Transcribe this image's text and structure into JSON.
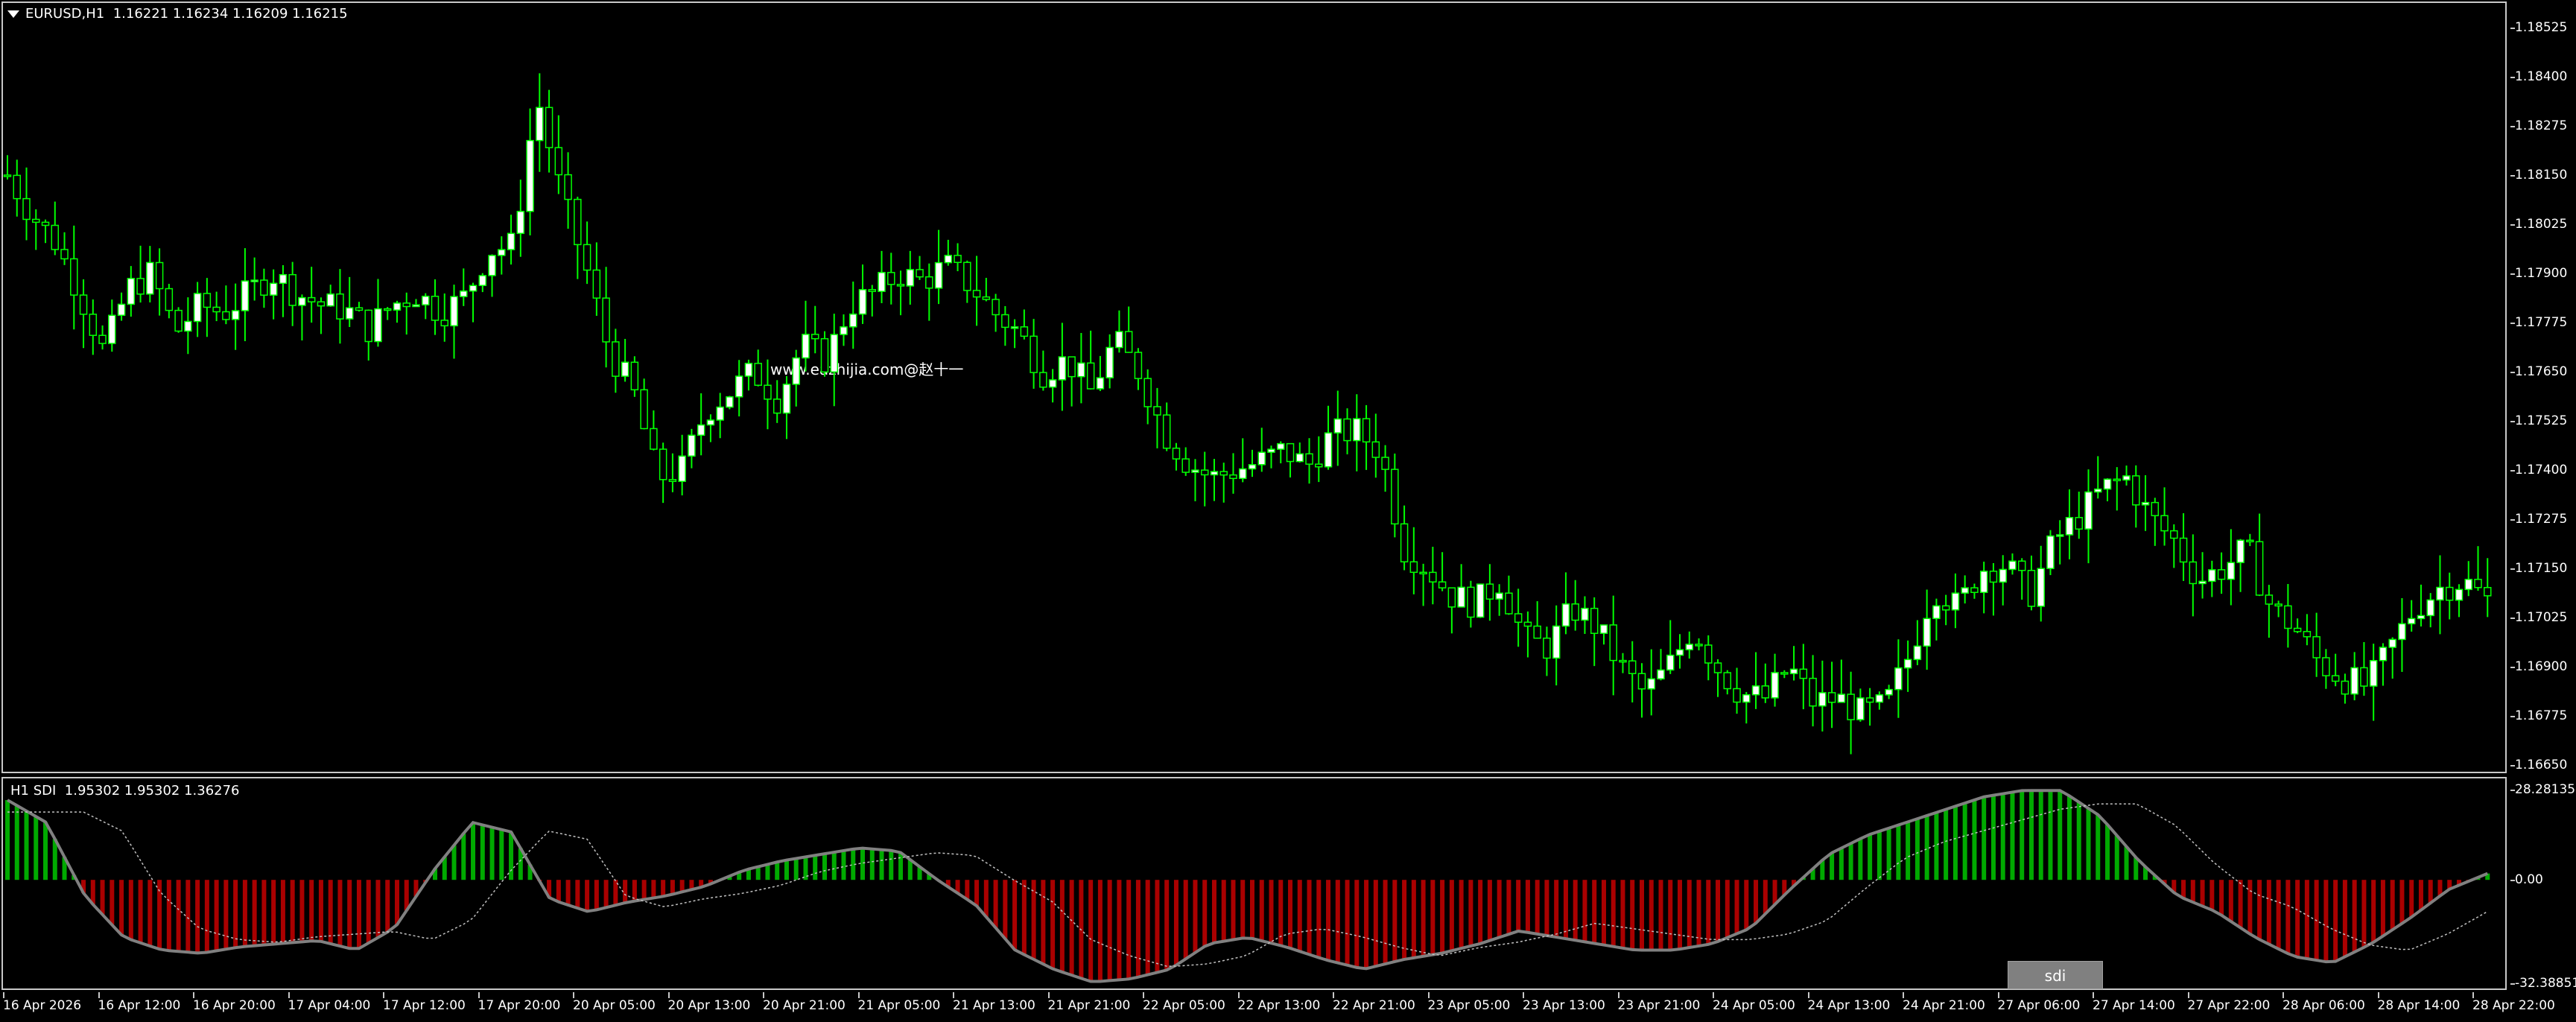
{
  "main_chart": {
    "symbol_label": "EURUSD,H1",
    "ohlc_label": "1.16221 1.16234 1.16209 1.16215",
    "watermark": "www.eazhijia.com@赵十一",
    "price_ticks": [
      "1.18525",
      "1.18400",
      "1.18275",
      "1.18150",
      "1.18025",
      "1.17900",
      "1.17775",
      "1.17650",
      "1.17525",
      "1.17400",
      "1.17275",
      "1.17150",
      "1.17025",
      "1.16900",
      "1.16775",
      "1.16650"
    ],
    "colors": {
      "bull_body": "#ffffff",
      "bear_body": "#000000",
      "wick": "#00ff00",
      "frame": "#c8c8c8"
    }
  },
  "indicator": {
    "label": "H1 SDI",
    "values_label": "1.95302 1.95302 1.36276",
    "ticks": [
      "28.28135",
      "0.00",
      "-32.38851"
    ],
    "colors": {
      "positive": "#00aa00",
      "negative": "#aa0000",
      "line": "#808080",
      "signal": "#c0c0c0"
    },
    "button_label": "sdi"
  },
  "time_axis": [
    "16 Apr 2026",
    "16 Apr 12:00",
    "16 Apr 20:00",
    "17 Apr 04:00",
    "17 Apr 12:00",
    "17 Apr 20:00",
    "20 Apr 05:00",
    "20 Apr 13:00",
    "20 Apr 21:00",
    "21 Apr 05:00",
    "21 Apr 13:00",
    "21 Apr 21:00",
    "22 Apr 05:00",
    "22 Apr 13:00",
    "22 Apr 21:00",
    "23 Apr 05:00",
    "23 Apr 13:00",
    "23 Apr 21:00",
    "24 Apr 05:00",
    "24 Apr 13:00",
    "24 Apr 21:00",
    "27 Apr 06:00",
    "27 Apr 14:00",
    "27 Apr 22:00",
    "28 Apr 06:00",
    "28 Apr 14:00",
    "28 Apr 22:00"
  ],
  "chart_data": [
    {
      "type": "candlestick",
      "title": "EURUSD,H1",
      "ylim": [
        1.1665,
        1.1865
      ],
      "close_path": [
        1.1815,
        1.1805,
        1.1798,
        1.1785,
        1.177,
        1.1786,
        1.179,
        1.1775,
        1.1782,
        1.178,
        1.1785,
        1.179,
        1.1785,
        1.1782,
        1.1781,
        1.1776,
        1.1782,
        1.1785,
        1.178,
        1.1784,
        1.1796,
        1.1797,
        1.1835,
        1.181,
        1.1792,
        1.177,
        1.176,
        1.1738,
        1.174,
        1.1755,
        1.176,
        1.1765,
        1.1758,
        1.1772,
        1.1768,
        1.1782,
        1.1785,
        1.179,
        1.1788,
        1.1792,
        1.1787,
        1.178,
        1.1775,
        1.1765,
        1.1768,
        1.176,
        1.1773,
        1.1765,
        1.175,
        1.1742,
        1.1738,
        1.174,
        1.1742,
        1.1745,
        1.1741,
        1.1749,
        1.175,
        1.1745,
        1.172,
        1.1715,
        1.1708,
        1.1706,
        1.1712,
        1.1697,
        1.1695,
        1.1705,
        1.17,
        1.169,
        1.1683,
        1.169,
        1.17,
        1.169,
        1.1683,
        1.1682,
        1.169,
        1.1681,
        1.1682,
        1.1678,
        1.168,
        1.1693,
        1.171,
        1.1705,
        1.1715,
        1.1716,
        1.1708,
        1.1722,
        1.1728,
        1.1735,
        1.1738,
        1.1728,
        1.1722,
        1.1712,
        1.1715,
        1.172,
        1.1705,
        1.17,
        1.1691,
        1.1687,
        1.1685,
        1.1695,
        1.1705,
        1.171,
        1.1712,
        1.1707
      ]
    },
    {
      "type": "bar",
      "title": "H1 SDI",
      "ylim": [
        -32.38851,
        28.28135
      ],
      "hist_path": [
        25,
        18,
        -5,
        -18,
        -22,
        -23,
        -21,
        -20,
        -19,
        -22,
        -15,
        3,
        18,
        15,
        -6,
        -10,
        -7,
        -5,
        -2,
        3,
        6,
        8,
        10,
        9,
        0,
        -8,
        -22,
        -28,
        -32,
        -31,
        -28,
        -20,
        -18,
        -21,
        -25,
        -28,
        -25,
        -23,
        -20,
        -16,
        -18,
        -20,
        -22,
        -22,
        -20,
        -15,
        -3,
        8,
        14,
        18,
        22,
        26,
        28,
        28,
        20,
        6,
        -5,
        -10,
        -18,
        -24,
        -26,
        -20,
        -12,
        -3,
        2
      ]
    }
  ]
}
